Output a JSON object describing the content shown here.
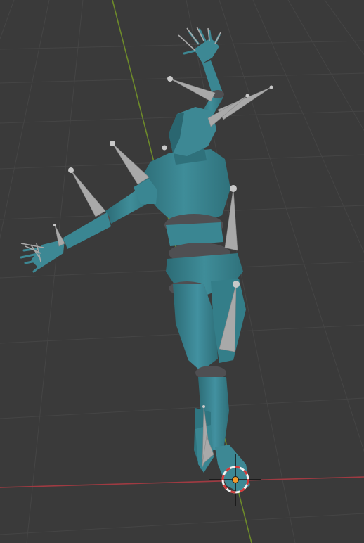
{
  "viewport": {
    "background_color": "#3a3a3a",
    "grid_color": "#454545",
    "x_axis_color": "#a03a42",
    "y_axis_color": "#6d8a2a"
  },
  "character": {
    "body_color": "#3d8894",
    "body_shadow_color": "#2a6670",
    "joint_color": "#4f4f52",
    "bone_color": "#a9a9a9"
  },
  "cursor_3d": {
    "ring_red": "#d23a3a",
    "ring_white": "#f2f2f2",
    "origin_color": "#f39a2a"
  }
}
